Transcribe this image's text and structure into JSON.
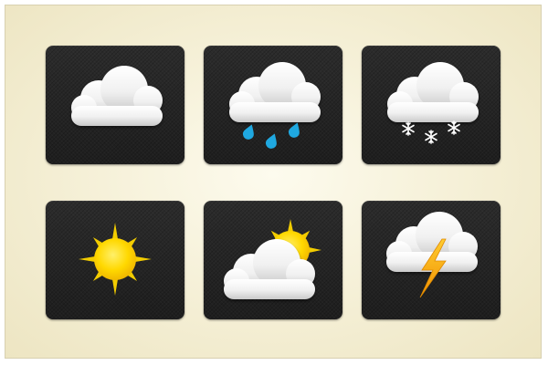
{
  "icons": [
    {
      "id": "cloudy",
      "icon": "cloud-icon"
    },
    {
      "id": "rain",
      "icon": "rain-cloud-icon"
    },
    {
      "id": "snow",
      "icon": "snow-cloud-icon"
    },
    {
      "id": "sunny",
      "icon": "sun-icon"
    },
    {
      "id": "partly-cloudy",
      "icon": "partly-cloudy-icon"
    },
    {
      "id": "thunderstorm",
      "icon": "thunder-cloud-icon"
    }
  ],
  "colors": {
    "page_bg": "#f6f1d9",
    "tile_bg": "#262626",
    "cloud_light": "#ffffff",
    "cloud_dark": "#cfcfcf",
    "rain_drop": "#1fa8e0",
    "snowflake": "#ffffff",
    "sun_core": "#ffd800",
    "sun_ray": "#f2cc00",
    "lightning": "#f5a800"
  }
}
